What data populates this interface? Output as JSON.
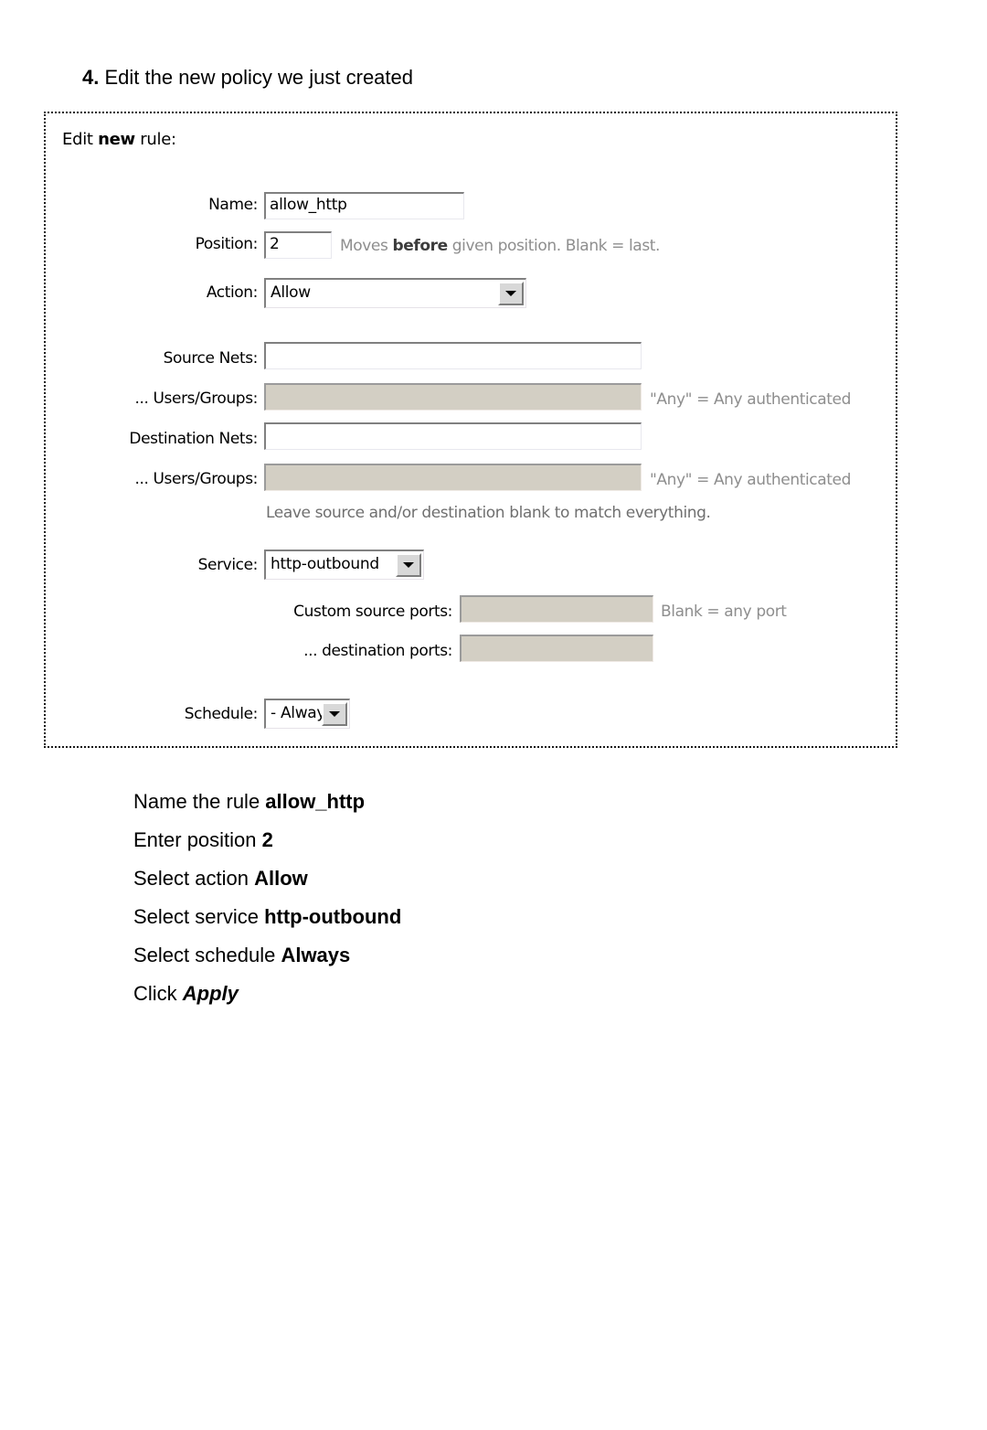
{
  "page": {
    "step_number": "4.",
    "step_title": "Edit the new policy we just created"
  },
  "screenshot": {
    "title_prefix": "Edit ",
    "title_bold": "new",
    "title_suffix": " rule:",
    "fields": {
      "name": {
        "label": "Name:",
        "value": "allow_http"
      },
      "position": {
        "label": "Position:",
        "value": "2",
        "note_pre": "Moves ",
        "note_bold": "before",
        "note_post": " given position. Blank = last."
      },
      "action": {
        "label": "Action:",
        "value": "Allow",
        "icon": "chevron-down-icon"
      },
      "source_nets": {
        "label": "Source Nets:",
        "value": ""
      },
      "source_users_groups": {
        "label": "... Users/Groups:",
        "value": "",
        "note": "\"Any\" = Any authenticated"
      },
      "destination_nets": {
        "label": "Destination Nets:",
        "value": ""
      },
      "destination_users_groups": {
        "label": "... Users/Groups:",
        "value": "",
        "note": "\"Any\" = Any authenticated"
      },
      "blank_hint": "Leave source and/or destination blank to match everything.",
      "service": {
        "label": "Service:",
        "value": "http-outbound",
        "icon": "chevron-down-icon"
      },
      "custom_source_ports": {
        "label": "Custom source ports:",
        "value": "",
        "note": "Blank = any port"
      },
      "custom_destination_ports": {
        "label": "... destination ports:",
        "value": ""
      },
      "schedule": {
        "label": "Schedule:",
        "value": "- Always -",
        "icon": "chevron-down-icon"
      }
    }
  },
  "instructions": [
    {
      "text": "Name the rule ",
      "emphasis": "allow_http",
      "style": "bold"
    },
    {
      "text": "Enter position ",
      "emphasis": "2",
      "style": "bold"
    },
    {
      "text": "Select action ",
      "emphasis": "Allow",
      "style": "bold"
    },
    {
      "text": "Select service ",
      "emphasis": "http-outbound",
      "style": "bold"
    },
    {
      "text": "Select schedule ",
      "emphasis": "Always",
      "style": "bold"
    },
    {
      "text": "Click ",
      "emphasis": "Apply",
      "style": "bold-italic"
    }
  ],
  "colors": {
    "text": "#000000",
    "note_gray": "#8e8e8e",
    "disabled_field": "#d3cfc4",
    "frame_border": "#1a1a1a",
    "field_border_dark": "#808080"
  }
}
